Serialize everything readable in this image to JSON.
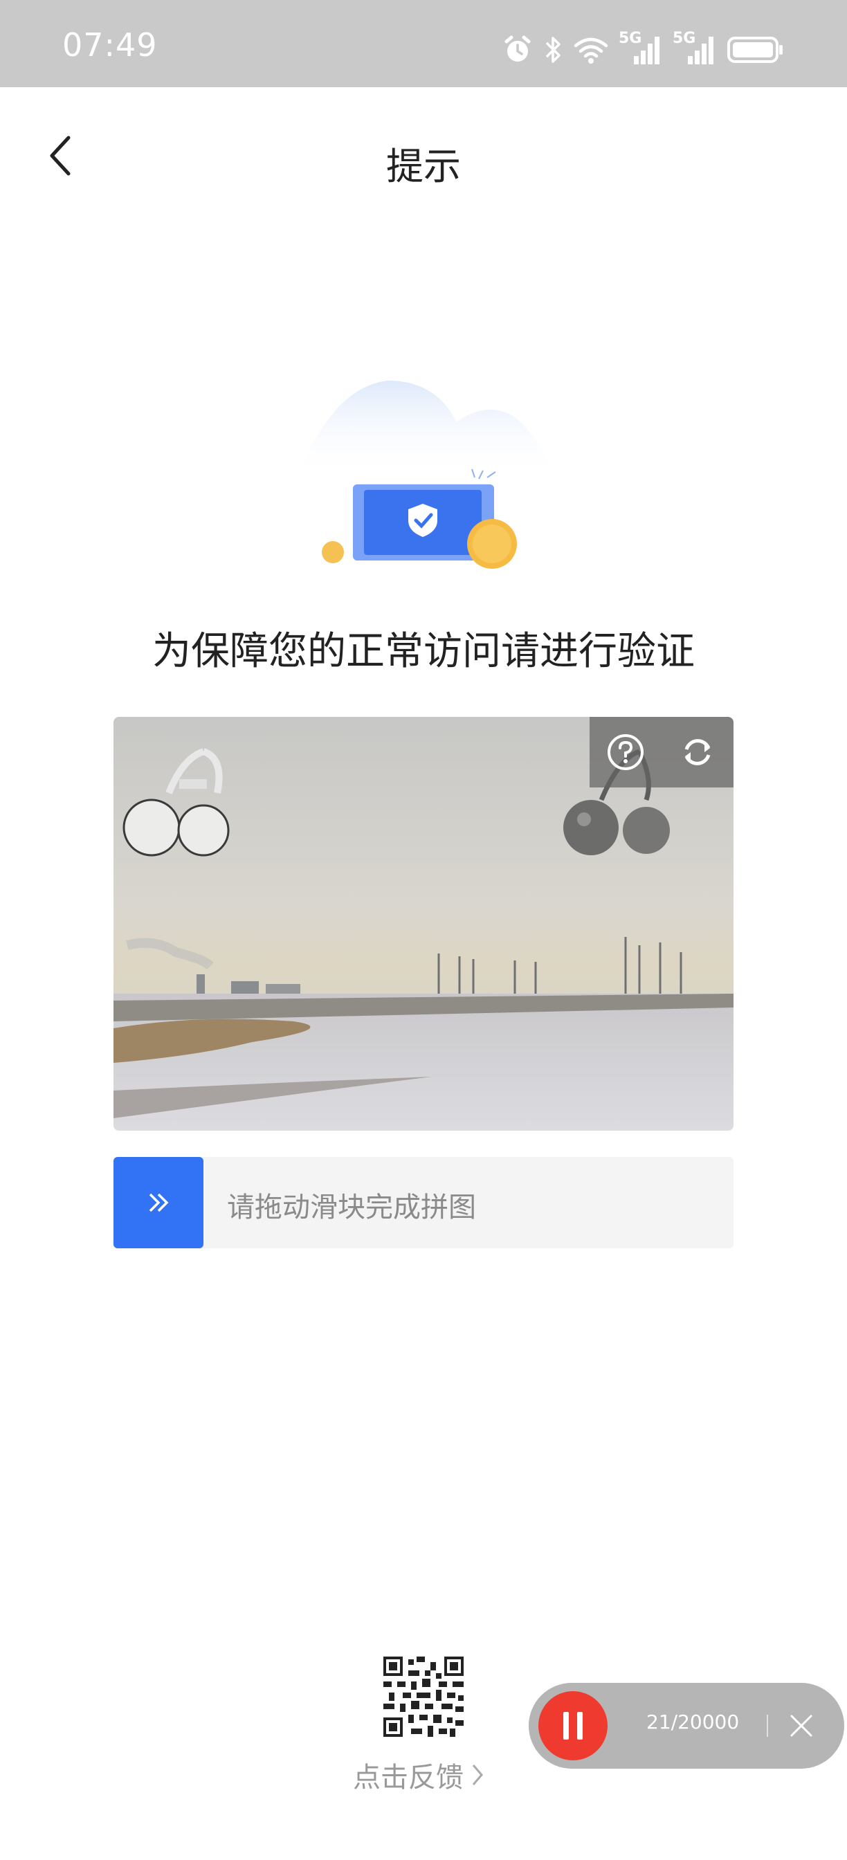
{
  "status_bar": {
    "time": "07:49",
    "icons": [
      "alarm-icon",
      "bluetooth-icon",
      "wifi-icon",
      "signal-5g-icon",
      "signal-5g-icon",
      "battery-icon"
    ],
    "network_label_1": "5G",
    "network_label_2": "5G"
  },
  "header": {
    "title": "提示",
    "back_icon": "chevron-left-icon"
  },
  "verification": {
    "heading": "为保障您的正常访问请进行验证",
    "help_icon": "question-circle-icon",
    "refresh_icon": "refresh-icon",
    "slider_hint": "请拖动滑块完成拼图",
    "slider_handle_icon": "double-chevron-right-icon",
    "accent_color": "#3273f6"
  },
  "feedback": {
    "label": "点击反馈",
    "qr_icon": "qr-code-icon"
  },
  "recorder": {
    "counter": "21/20000",
    "pause_icon": "pause-icon",
    "close_icon": "close-icon",
    "record_color": "#ef3b2f"
  }
}
